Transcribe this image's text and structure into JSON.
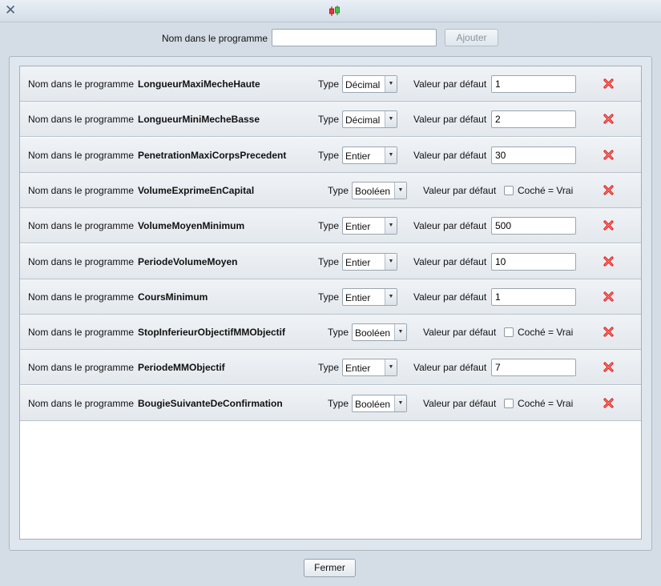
{
  "window": {
    "title": ""
  },
  "top": {
    "name_label": "Nom dans le programme",
    "name_value": "",
    "add_button": "Ajouter"
  },
  "labels": {
    "name": "Nom dans le programme",
    "type": "Type",
    "default": "Valeur par défaut",
    "checked_true": "Coché = Vrai"
  },
  "rows": [
    {
      "name": "LongueurMaxiMecheHaute",
      "type": "Décimal",
      "value": "1"
    },
    {
      "name": "LongueurMiniMecheBasse",
      "type": "Décimal",
      "value": "2"
    },
    {
      "name": "PenetrationMaxiCorpsPrecedent",
      "type": "Entier",
      "value": "30"
    },
    {
      "name": "VolumeExprimeEnCapital",
      "type": "Booléen",
      "value": ""
    },
    {
      "name": "VolumeMoyenMinimum",
      "type": "Entier",
      "value": "500"
    },
    {
      "name": "PeriodeVolumeMoyen",
      "type": "Entier",
      "value": "10"
    },
    {
      "name": "CoursMinimum",
      "type": "Entier",
      "value": "1"
    },
    {
      "name": "StopInferieurObjectifMMObjectif",
      "type": "Booléen",
      "value": ""
    },
    {
      "name": "PeriodeMMObjectif",
      "type": "Entier",
      "value": "7"
    },
    {
      "name": "BougieSuivanteDeConfirmation",
      "type": "Booléen",
      "value": ""
    }
  ],
  "footer": {
    "close_button": "Fermer"
  },
  "colors": {
    "delete_icon": "#e02020",
    "background": "#d4dde6"
  }
}
